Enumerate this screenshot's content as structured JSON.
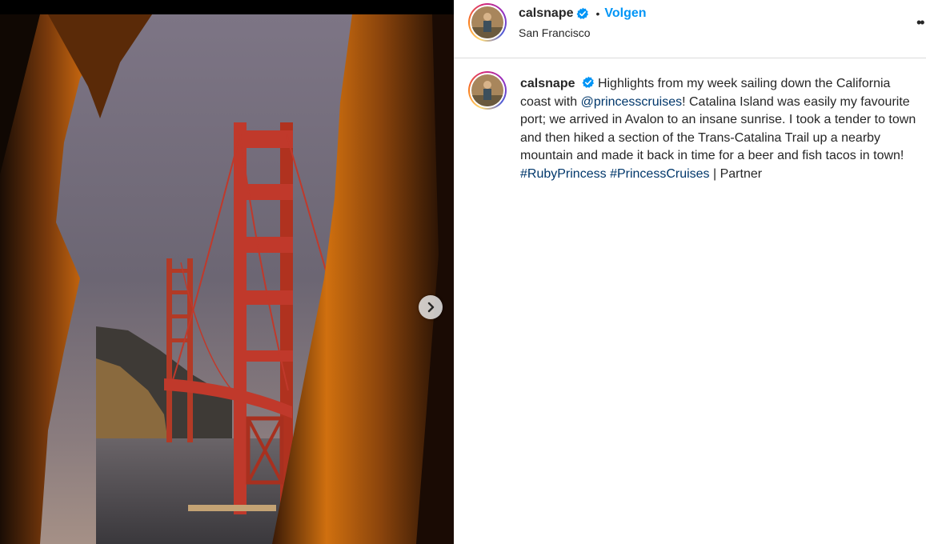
{
  "post": {
    "username": "calsnape",
    "follow_label": "Volgen",
    "separator": "•",
    "location": "San Francisco",
    "more_icon": "more-icon",
    "verified_icon": "verified-badge-icon",
    "caption": {
      "text_1": "Highlights from my week sailing down the California coast with ",
      "mention": "@princesscruises",
      "text_2": "! Catalina Island was easily my favourite port; we arrived in Avalon to an insane sunrise. I took a tender to town and then hiked a section of the Trans-Catalina Trail up a nearby mountain and made it back in time for a beer and fish tacos in town! ",
      "hashtag_1": "#RubyPrincess",
      "hashtag_2": "#PrincessCruises",
      "text_3": " | Partner"
    },
    "carousel_next_icon": "chevron-right-icon"
  },
  "colors": {
    "follow": "#0095f6",
    "link": "#00376b",
    "verified": "#0095f6",
    "bridge": "#c0392b"
  }
}
